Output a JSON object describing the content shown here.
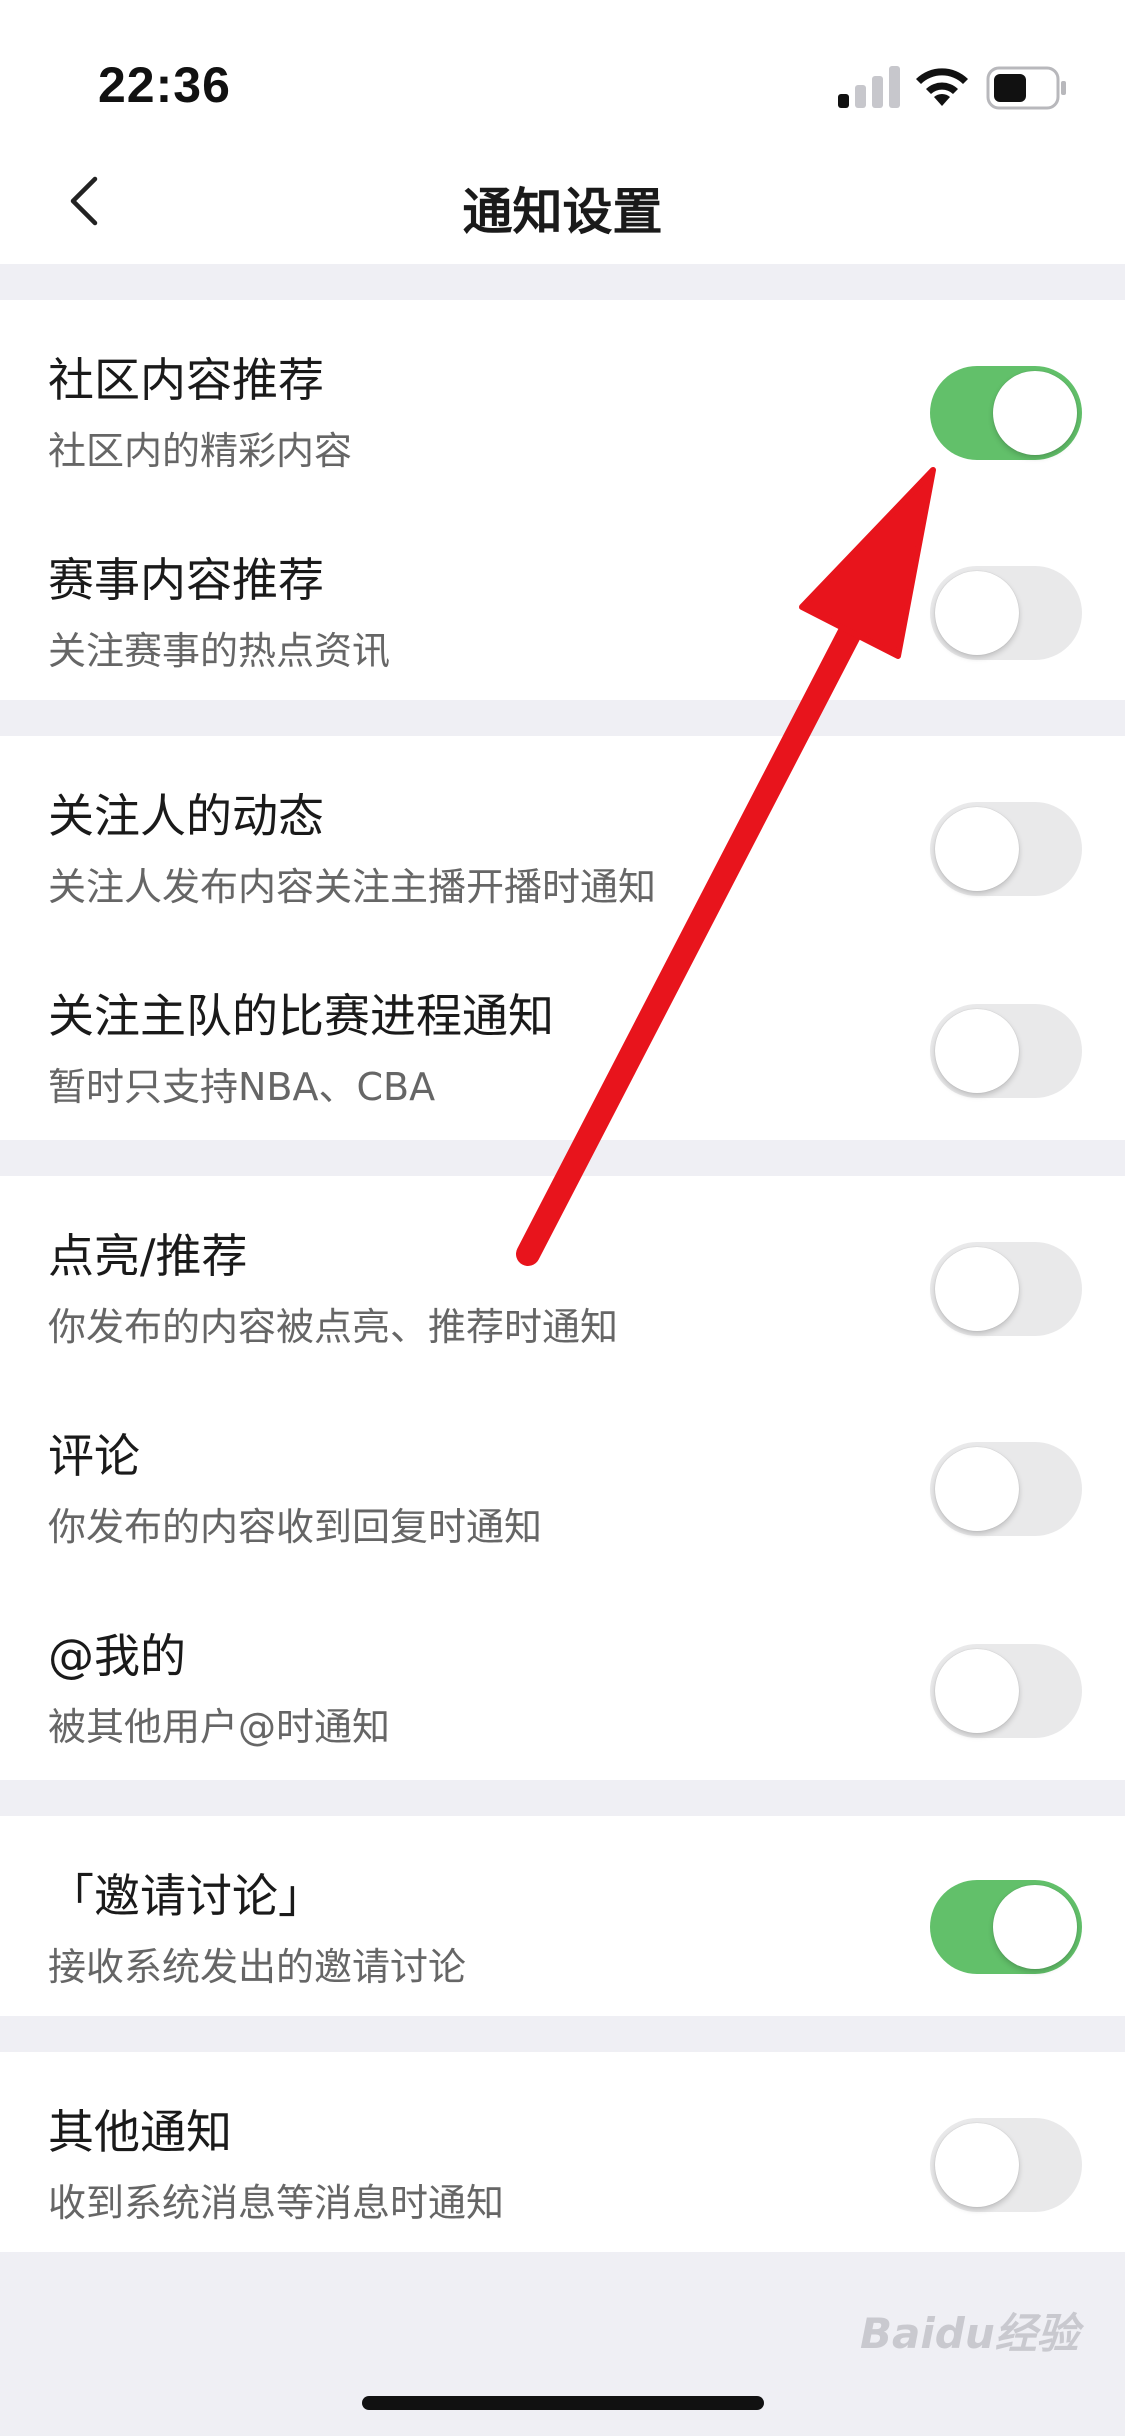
{
  "status_bar": {
    "time": "22:36"
  },
  "nav": {
    "title": "通知设置"
  },
  "groups": [
    {
      "items": [
        {
          "title": "社区内容推荐",
          "subtitle": "社区内的精彩内容",
          "enabled": true
        },
        {
          "title": "赛事内容推荐",
          "subtitle": "关注赛事的热点资讯",
          "enabled": false
        }
      ]
    },
    {
      "items": [
        {
          "title": "关注人的动态",
          "subtitle": "关注人发布内容关注主播开播时通知",
          "enabled": false
        },
        {
          "title": "关注主队的比赛进程通知",
          "subtitle": "暂时只支持NBA、CBA",
          "enabled": false
        }
      ]
    },
    {
      "items": [
        {
          "title": "点亮/推荐",
          "subtitle": "你发布的内容被点亮、推荐时通知",
          "enabled": false
        },
        {
          "title": "评论",
          "subtitle": "你发布的内容收到回复时通知",
          "enabled": false
        },
        {
          "title": "@我的",
          "subtitle": "被其他用户@时通知",
          "enabled": false
        }
      ]
    },
    {
      "items": [
        {
          "title": "「邀请讨论」",
          "subtitle": "接收系统发出的邀请讨论",
          "enabled": true
        }
      ]
    },
    {
      "items": [
        {
          "title": "其他通知",
          "subtitle": "收到系统消息等消息时通知",
          "enabled": false
        }
      ]
    }
  ],
  "watermark": "Baidu经验",
  "colors": {
    "toggle_on": "#62c06a",
    "toggle_off": "#e9e9ea",
    "annotation_arrow": "#e8141c",
    "background": "#efeff4"
  }
}
